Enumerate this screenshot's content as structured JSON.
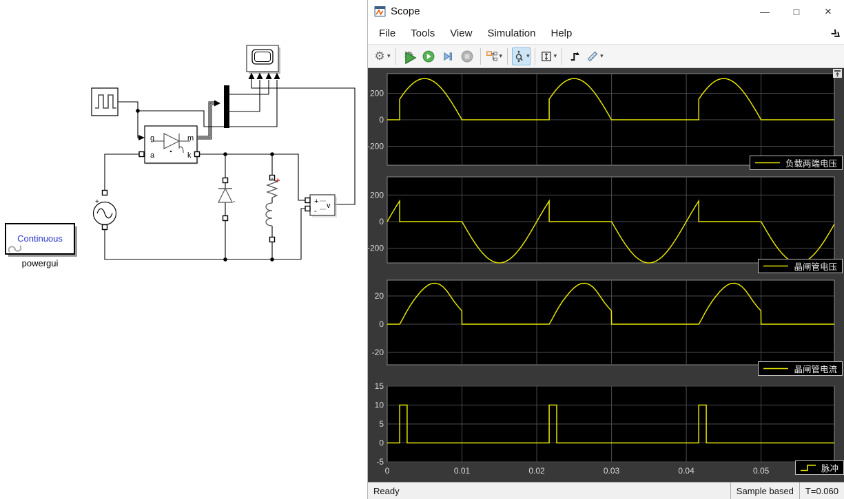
{
  "window": {
    "title": "Scope",
    "minimize_label": "—",
    "maximize_label": "□",
    "close_label": "×"
  },
  "menu": {
    "items": [
      "File",
      "Tools",
      "View",
      "Simulation",
      "Help"
    ]
  },
  "toolbar": {
    "buttons": [
      {
        "name": "settings",
        "icon": "gear-icon",
        "dropdown": true
      },
      {
        "type": "sep"
      },
      {
        "name": "highlight-block",
        "icon": "gear-run-icon"
      },
      {
        "name": "run",
        "icon": "play-icon"
      },
      {
        "name": "step-forward",
        "icon": "step-forward-icon"
      },
      {
        "name": "stop",
        "icon": "stop-icon",
        "disabled": true
      },
      {
        "type": "sep"
      },
      {
        "name": "signal-selector",
        "icon": "signal-selector-icon",
        "dropdown": true
      },
      {
        "type": "sep"
      },
      {
        "name": "zoom",
        "icon": "zoom-icon",
        "dropdown": true,
        "selected": true
      },
      {
        "type": "sep"
      },
      {
        "name": "scale-axes",
        "icon": "scale-axes-icon",
        "dropdown": true
      },
      {
        "type": "sep"
      },
      {
        "name": "trigger",
        "icon": "trigger-icon"
      },
      {
        "name": "measurements",
        "icon": "ruler-icon",
        "dropdown": true
      }
    ]
  },
  "status": {
    "ready": "Ready",
    "mode": "Sample based",
    "time": "T=0.060"
  },
  "diagram": {
    "powergui": {
      "mode": "Continuous",
      "label": "powergui"
    },
    "thyristor": {
      "g": "g",
      "a": "a",
      "m": "m",
      "k": "k"
    },
    "voltage_measurement": {
      "plus": "+",
      "minus": "-",
      "v": "v"
    },
    "ac_source": {
      "plus": "+"
    },
    "rl_branch": {
      "plus": "+"
    }
  },
  "chart_data": [
    {
      "type": "line",
      "legend": "负载两端电压",
      "legend_icon": "line",
      "color": "#e6e600",
      "xlim": [
        0,
        0.0598
      ],
      "ylim_top": 348,
      "ylim_bottom": -343,
      "yticks": [
        200,
        0,
        -200
      ],
      "grid": true,
      "segments": [
        {
          "kind": "const",
          "t0": 0,
          "t1": 0.001667,
          "v": 0
        },
        {
          "kind": "sine",
          "t0": 0.001667,
          "t1": 0.01,
          "amp": 311,
          "freq": 50
        },
        {
          "kind": "const",
          "t0": 0.01,
          "t1": 0.021667,
          "v": 0
        },
        {
          "kind": "sine",
          "t0": 0.021667,
          "t1": 0.03,
          "amp": 311,
          "freq": 50
        },
        {
          "kind": "const",
          "t0": 0.03,
          "t1": 0.041667,
          "v": 0
        },
        {
          "kind": "sine",
          "t0": 0.041667,
          "t1": 0.05,
          "amp": 311,
          "freq": 50
        },
        {
          "kind": "const",
          "t0": 0.05,
          "t1": 0.0598,
          "v": 0
        }
      ]
    },
    {
      "type": "line",
      "legend": "晶闸管电压",
      "legend_icon": "line",
      "color": "#e6e600",
      "xlim": [
        0,
        0.0598
      ],
      "ylim_top": 337,
      "ylim_bottom": -311,
      "yticks": [
        200,
        0,
        -200
      ],
      "grid": true,
      "segments": [
        {
          "kind": "sine",
          "t0": 0,
          "t1": 0.001667,
          "amp": 311,
          "freq": 50
        },
        {
          "kind": "const",
          "t0": 0.001667,
          "t1": 0.01,
          "v": 0
        },
        {
          "kind": "sine",
          "t0": 0.01,
          "t1": 0.021667,
          "amp": 311,
          "freq": 50
        },
        {
          "kind": "const",
          "t0": 0.021667,
          "t1": 0.03,
          "v": 0
        },
        {
          "kind": "sine",
          "t0": 0.03,
          "t1": 0.041667,
          "amp": 311,
          "freq": 50
        },
        {
          "kind": "const",
          "t0": 0.041667,
          "t1": 0.05,
          "v": 0
        },
        {
          "kind": "sine",
          "t0": 0.05,
          "t1": 0.0598,
          "amp": 311,
          "freq": 50
        }
      ]
    },
    {
      "type": "line",
      "legend": "晶闸管电流",
      "legend_icon": "line",
      "color": "#e6e600",
      "xlim": [
        0,
        0.0598
      ],
      "ylim_top": 31.2,
      "ylim_bottom": -28.8,
      "yticks": [
        20,
        0,
        -20
      ],
      "grid": true,
      "segments": [
        {
          "kind": "const",
          "t0": 0,
          "t1": 0.001667,
          "v": 0
        },
        {
          "kind": "points",
          "repeat": 3,
          "period": 0.02,
          "pts": [
            [
              0.001667,
              0
            ],
            [
              0.002,
              3
            ],
            [
              0.0025,
              8
            ],
            [
              0.003,
              12.5
            ],
            [
              0.0035,
              16.5
            ],
            [
              0.004,
              20
            ],
            [
              0.0045,
              23.2
            ],
            [
              0.005,
              25.8
            ],
            [
              0.0055,
              27.8
            ],
            [
              0.006,
              28.9
            ],
            [
              0.0065,
              29
            ],
            [
              0.007,
              28.2
            ],
            [
              0.0075,
              26.3
            ],
            [
              0.008,
              23.4
            ],
            [
              0.0085,
              19.6
            ],
            [
              0.009,
              15.7
            ],
            [
              0.0095,
              12.3
            ],
            [
              0.00998,
              9.5
            ],
            [
              0.01,
              0
            ]
          ]
        },
        {
          "kind": "const",
          "t0": 0.05,
          "t1": 0.0598,
          "v": 0
        }
      ]
    },
    {
      "type": "step",
      "legend": "脉冲",
      "legend_icon": "step",
      "color": "#e6e600",
      "xlim": [
        0,
        0.0598
      ],
      "ylim_top": 15,
      "ylim_bottom": -5,
      "yticks": [
        15,
        10,
        5,
        0,
        -5
      ],
      "grid": true,
      "xticks": {
        "values": [
          0,
          0.01,
          0.02,
          0.03,
          0.04,
          0.05
        ],
        "labels": [
          "0",
          "0.01",
          "0.02",
          "0.03",
          "0.04",
          "0.05"
        ]
      },
      "segments": [
        {
          "kind": "const",
          "t0": 0,
          "t1": 0.001667,
          "v": 0
        },
        {
          "kind": "const",
          "t0": 0.001667,
          "t1": 0.002667,
          "v": 10
        },
        {
          "kind": "const",
          "t0": 0.002667,
          "t1": 0.021667,
          "v": 0
        },
        {
          "kind": "const",
          "t0": 0.021667,
          "t1": 0.022667,
          "v": 10
        },
        {
          "kind": "const",
          "t0": 0.022667,
          "t1": 0.041667,
          "v": 0
        },
        {
          "kind": "const",
          "t0": 0.041667,
          "t1": 0.042667,
          "v": 10
        },
        {
          "kind": "const",
          "t0": 0.042667,
          "t1": 0.0598,
          "v": 0
        }
      ]
    }
  ],
  "colors": {
    "trace": "#e6e600",
    "plot_bg": "#000000",
    "canvas_bg": "#383838",
    "grid": "#4d4d4d",
    "axes_border": "#8a8a8a",
    "tick_text": "#d9d9d9",
    "selected_button_bg": "#cde6f7",
    "powergui_text": "#2a35c8",
    "rl_plus": "#cc1111"
  }
}
